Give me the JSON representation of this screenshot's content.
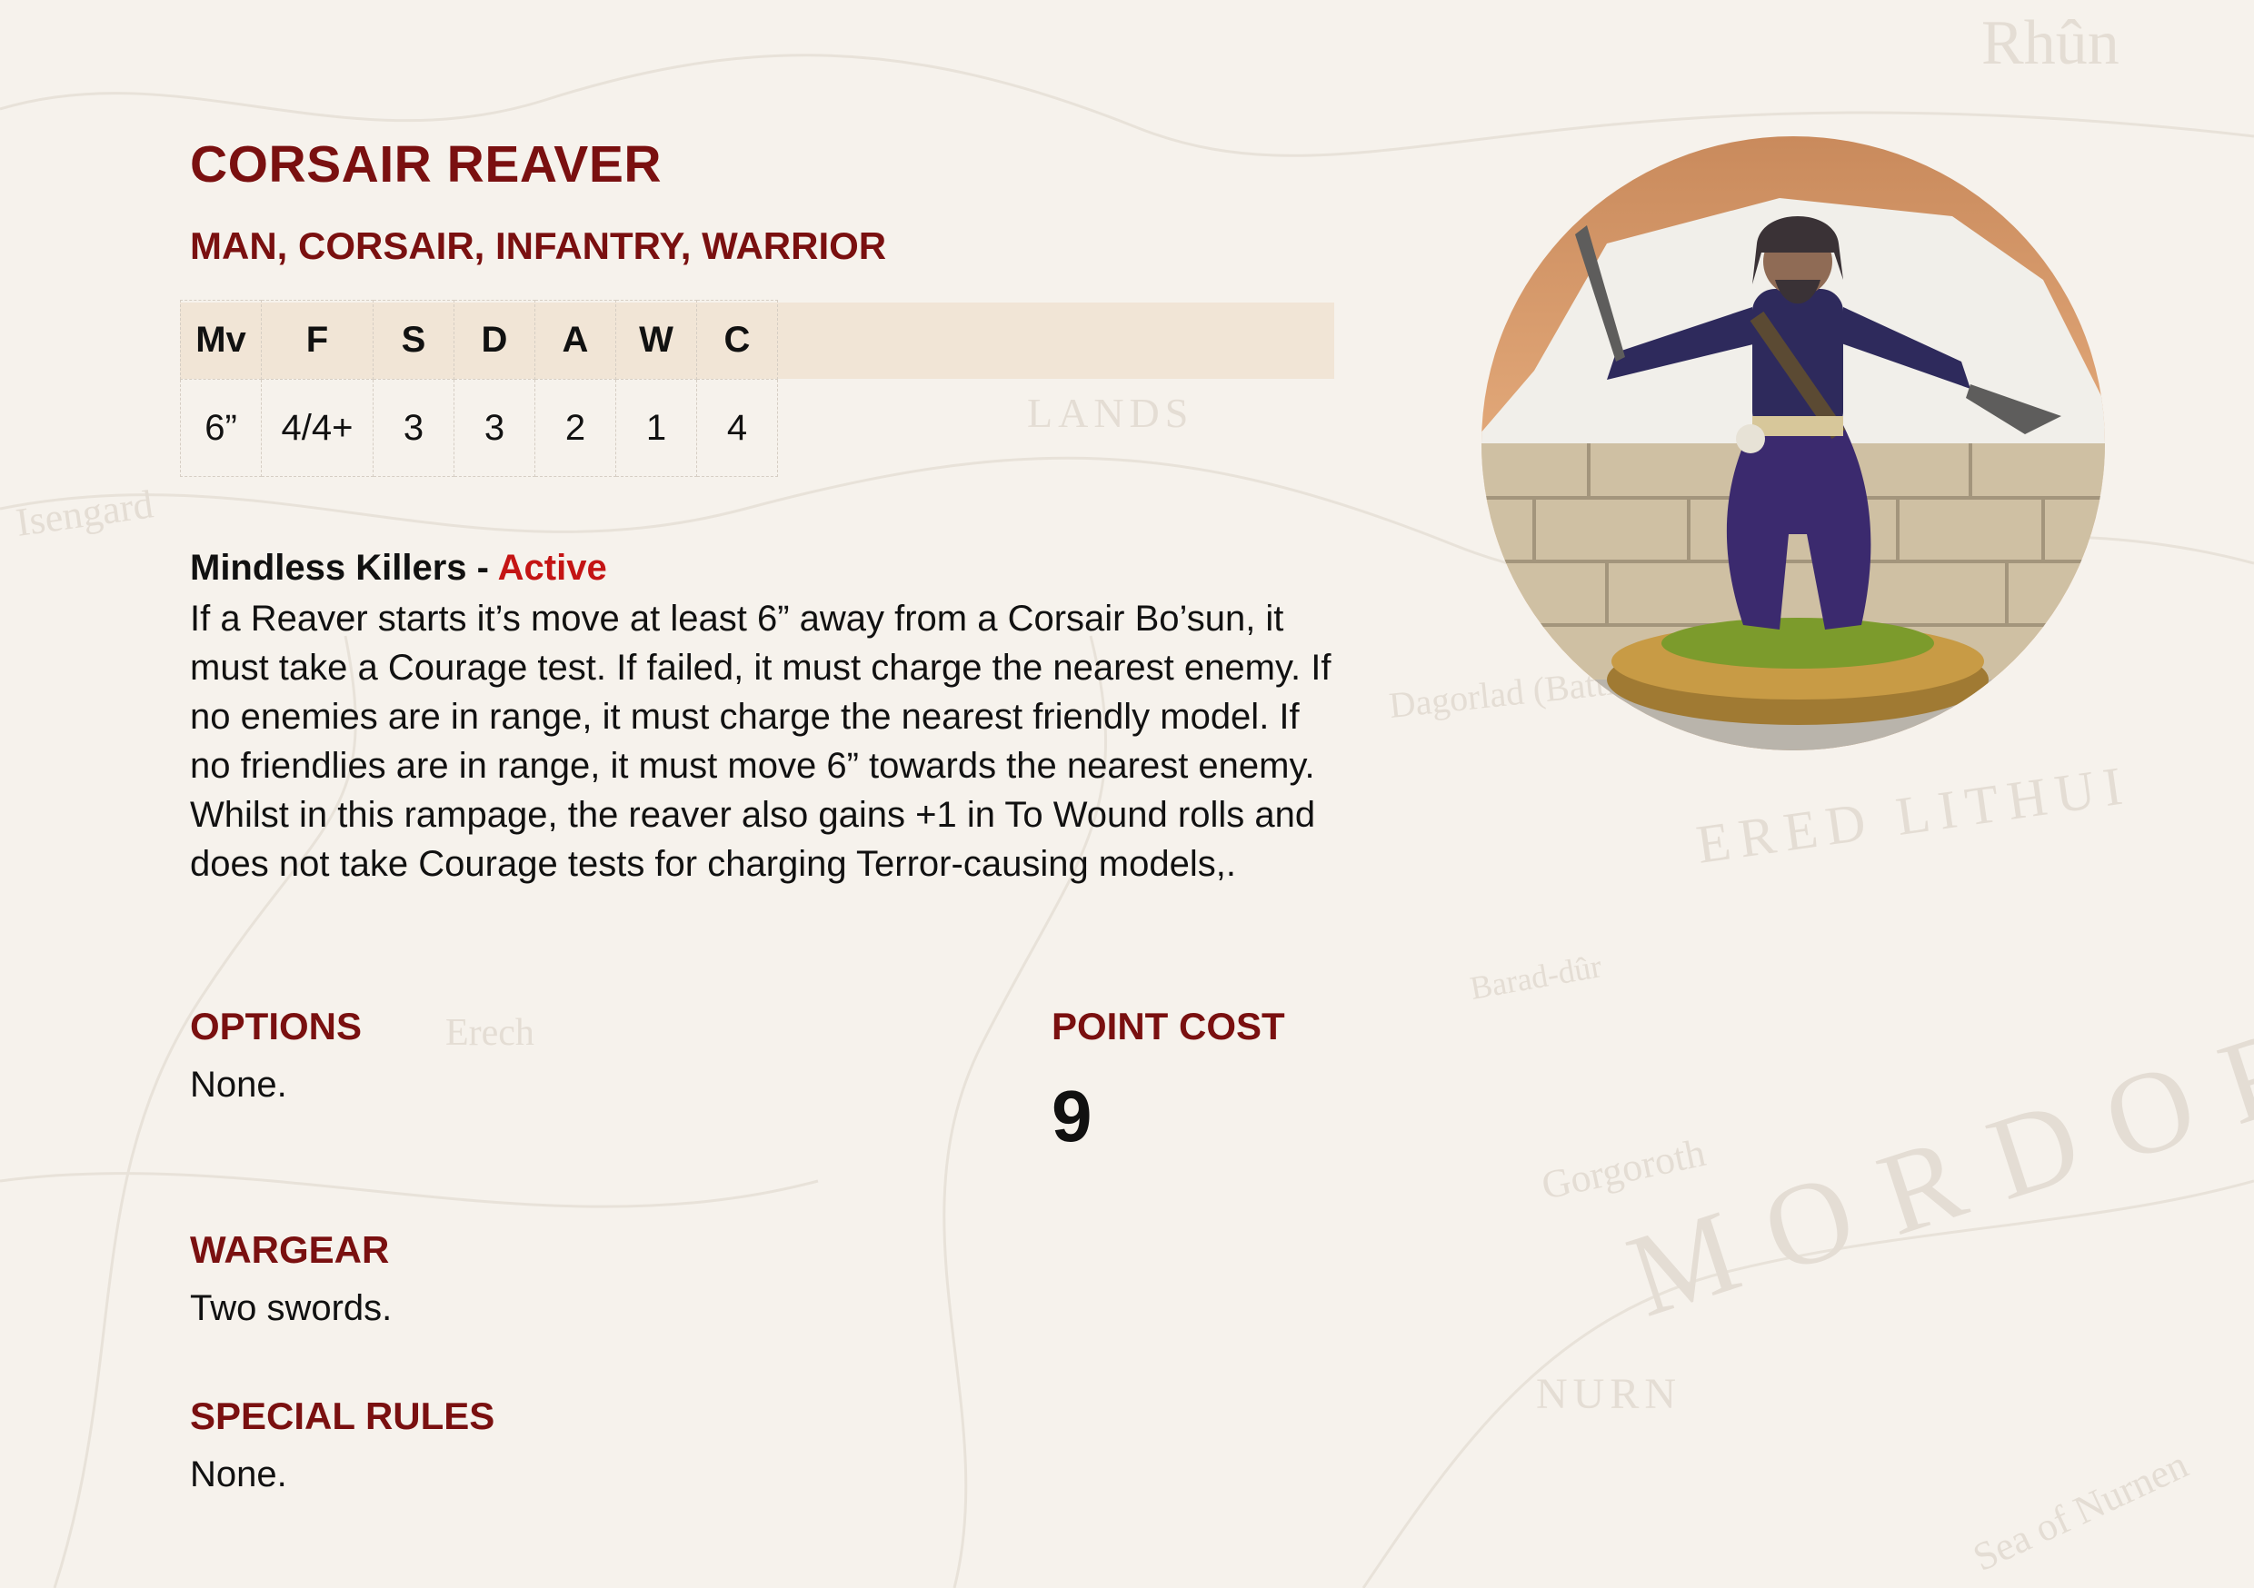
{
  "profile": {
    "name": "CORSAIR REAVER",
    "keywords": "MAN, CORSAIR, INFANTRY, WARRIOR"
  },
  "stats": {
    "headers": [
      "Mv",
      "F",
      "S",
      "D",
      "A",
      "W",
      "C"
    ],
    "values": [
      "6”",
      "4/4+",
      "3",
      "3",
      "2",
      "1",
      "4"
    ]
  },
  "ability": {
    "name": "Mindless Killers",
    "separator": " - ",
    "type": "Active",
    "text": "If a Reaver starts it’s move at least 6” away from a Corsair Bo’sun, it must take a Courage test. If failed, it must charge the nearest enemy. If no enemies are in range, it must charge the nearest friendly model. If no friendlies are in range, it must move 6” towards the nearest enemy. Whilst in this rampage, the reaver also gains +1 in To Wound rolls and does not take Courage tests for charging Terror-causing models,."
  },
  "options": {
    "heading": "OPTIONS",
    "value": "None."
  },
  "point_cost": {
    "heading": "POINT COST",
    "value": "9"
  },
  "wargear": {
    "heading": "WARGEAR",
    "value": "Two swords."
  },
  "special_rules": {
    "heading": "SPECIAL RULES",
    "value": "None."
  },
  "background_map_labels": [
    "Rhûn",
    "MORDOR",
    "Isengard",
    "Dagorlad (Battle Plain)",
    "ERED LITHUI",
    "Gorgoroth",
    "NURN",
    "Sea of Nurnen",
    "Barad-dûr",
    "LANDS",
    "Erech"
  ],
  "colors": {
    "heading": "#7a1010",
    "active": "#c41414",
    "stat_header_bg": "#f1e5d6",
    "page_bg": "#f6f2ec"
  }
}
